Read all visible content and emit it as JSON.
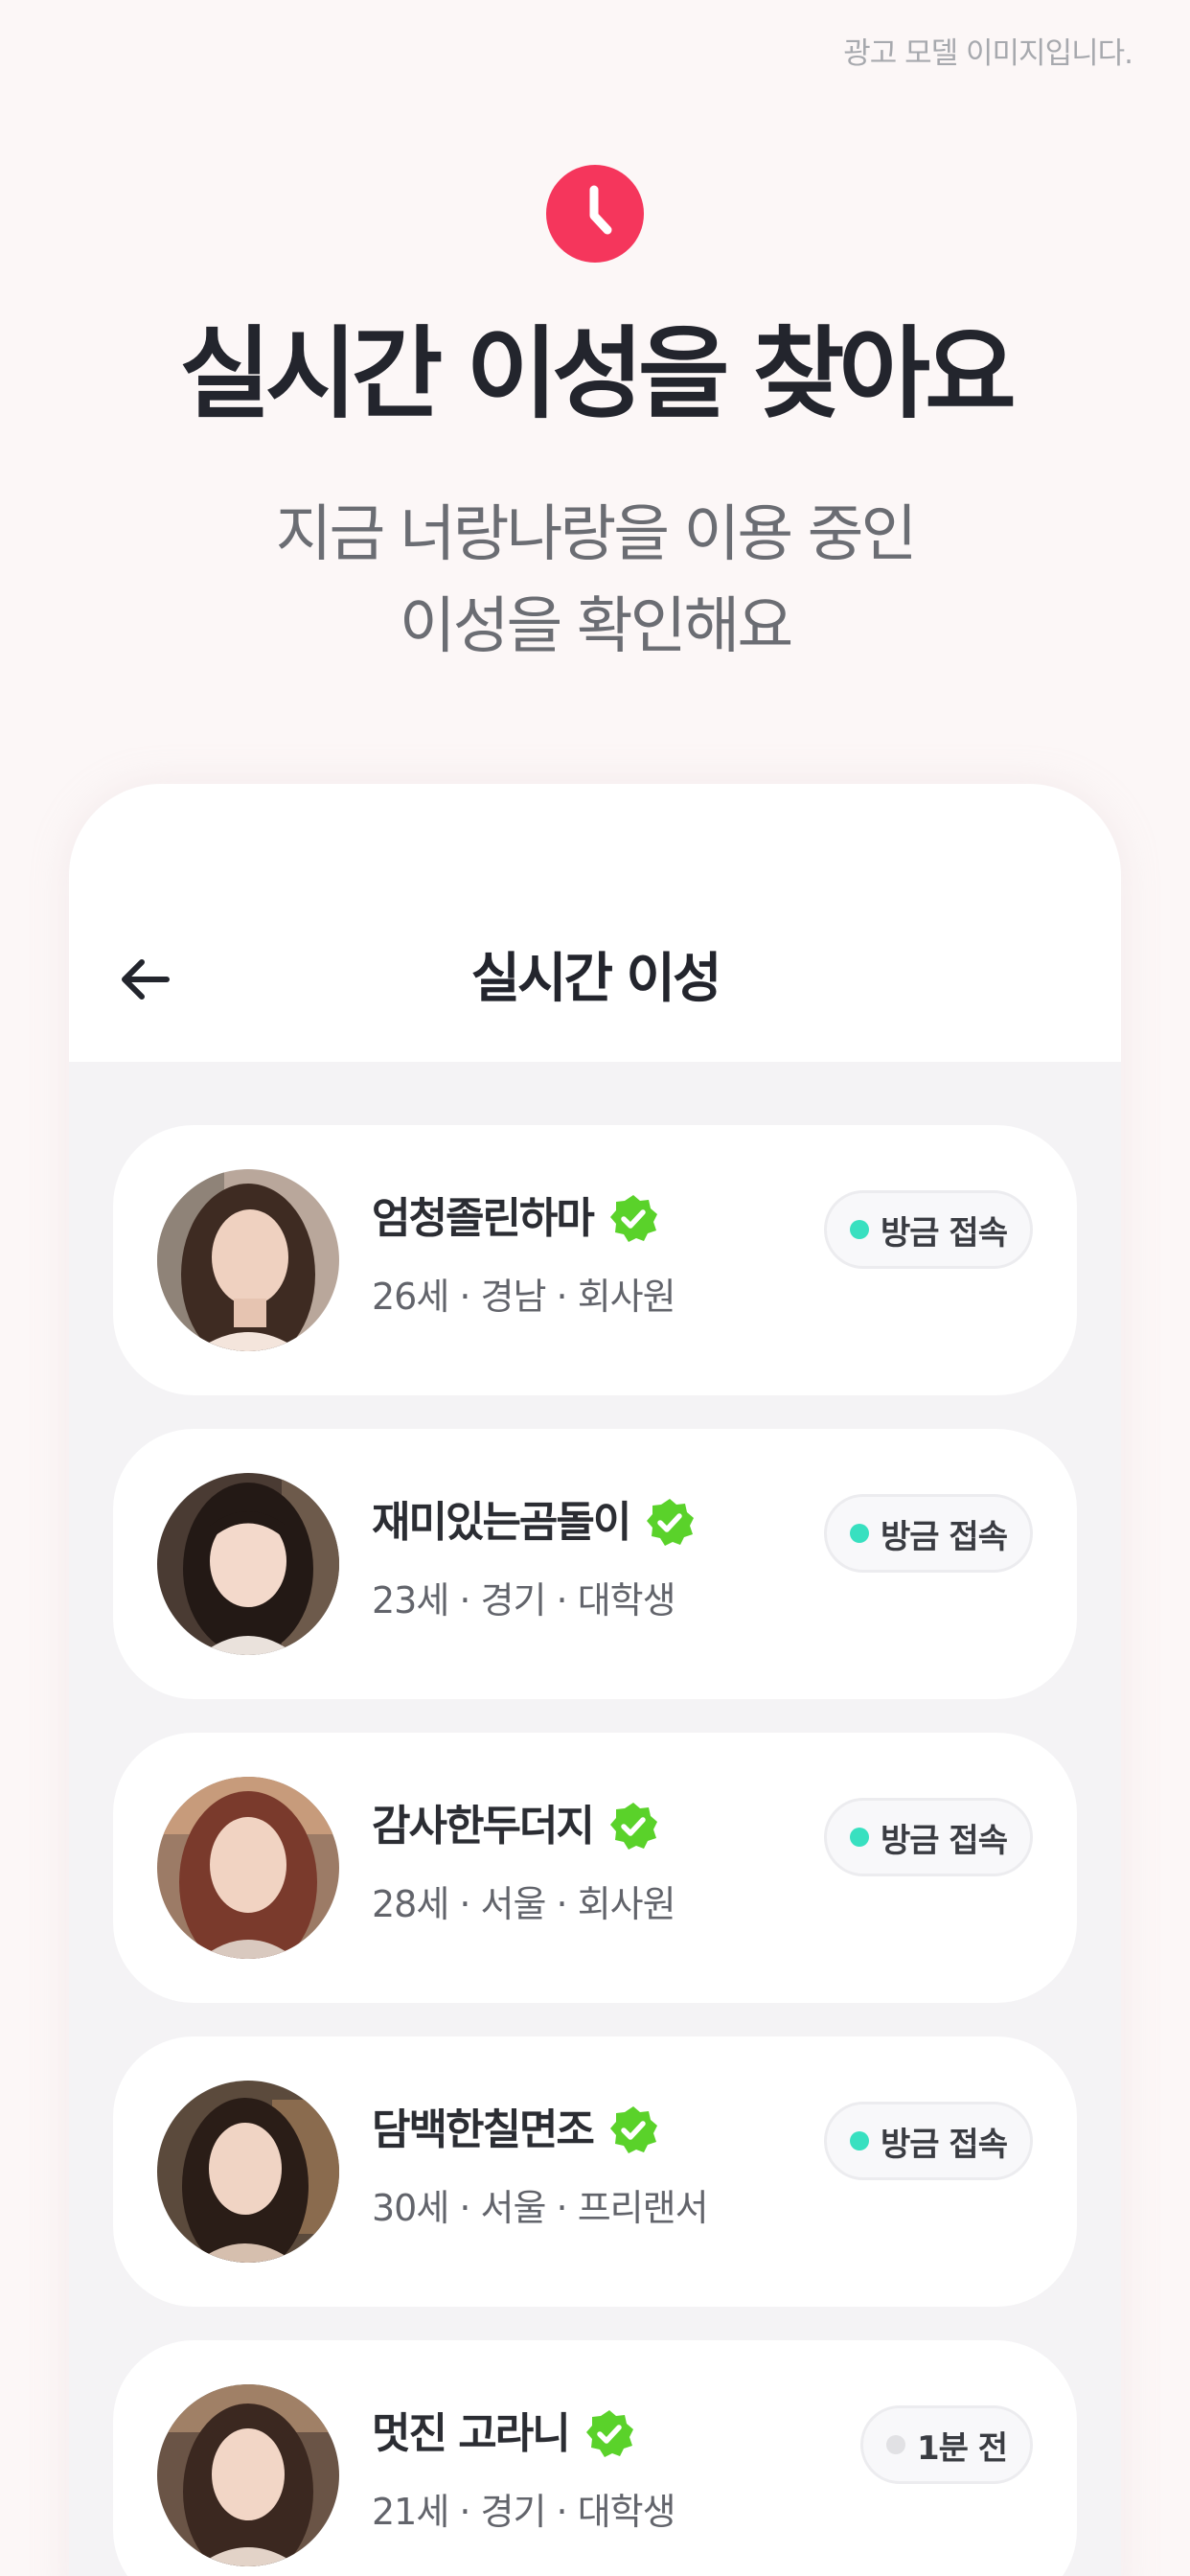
{
  "ad_notice": "광고 모델 이미지입니다.",
  "icons": {
    "top": "clock-icon",
    "back": "arrow-left-icon",
    "verified": "verified-badge-icon"
  },
  "colors": {
    "accent": "#f5365c",
    "online": "#38e0c0",
    "verified": "#5ad22a"
  },
  "headline": "실시간 이성을 찾아요",
  "subtitle": {
    "line1": "지금 너랑나랑을 이용 중인",
    "line2": "이성을 확인해요"
  },
  "screen": {
    "title": "실시간 이성",
    "users": [
      {
        "name": "엄청졸린하마",
        "meta": "26세 · 경남 · 회사원",
        "status": "방금 접속",
        "online": true
      },
      {
        "name": "재미있는곰돌이",
        "meta": "23세 · 경기 · 대학생",
        "status": "방금 접속",
        "online": true
      },
      {
        "name": "감사한두더지",
        "meta": "28세 · 서울 · 회사원",
        "status": "방금 접속",
        "online": true
      },
      {
        "name": "담백한칠면조",
        "meta": "30세 · 서울 · 프리랜서",
        "status": "방금 접속",
        "online": true
      },
      {
        "name": "멋진 고라니",
        "meta": "21세 · 경기 · 대학생",
        "status": "1분 전",
        "online": false
      }
    ]
  }
}
